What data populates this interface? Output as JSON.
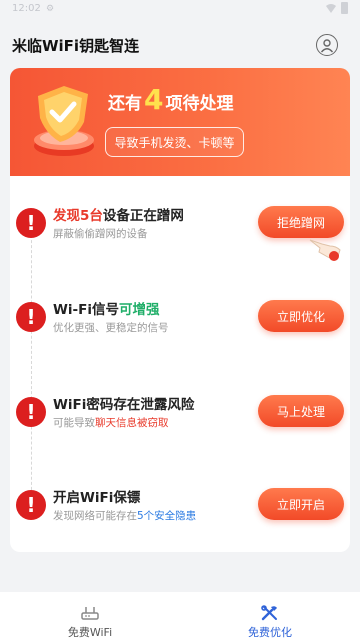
{
  "status_bar": {
    "time": "12:02",
    "indicator": "⚙"
  },
  "header": {
    "title": "米临WiFi钥匙智连"
  },
  "hero": {
    "title_prefix": "还有",
    "count": "4",
    "title_suffix": "项待处理",
    "button_label": "导致手机发烫、卡顿等"
  },
  "items": [
    {
      "title_red": "发现5台",
      "title_rest": "设备正在蹭网",
      "subtitle": "屏蔽偷偷蹭网的设备",
      "button": "拒绝蹭网",
      "icon": "exclamation-icon"
    },
    {
      "title_start": "Wi-Fi信号",
      "title_green": "可增强",
      "subtitle": "优化更强、更稳定的信号",
      "button": "立即优化",
      "icon": "exclamation-icon"
    },
    {
      "title": "WiFi密码存在泄露风险",
      "subtitle_start": "可能导致",
      "subtitle_red": "聊天信息被窃取",
      "button": "马上处理",
      "icon": "exclamation-icon"
    },
    {
      "title": "开启WiFi保镖",
      "subtitle_start": "发现网络可能存在",
      "subtitle_blue": "5个安全隐患",
      "button": "立即开启",
      "icon": "exclamation-icon"
    }
  ],
  "bottom_nav": {
    "tabs": [
      {
        "label": "免费WiFi",
        "icon": "router-icon",
        "active": false
      },
      {
        "label": "免费优化",
        "icon": "tools-icon",
        "active": true
      }
    ]
  },
  "colors": {
    "accent": "#f24a28",
    "alert": "#dc1f1f",
    "nav_active": "#2f63d8",
    "highlight": "#ffe14d"
  }
}
